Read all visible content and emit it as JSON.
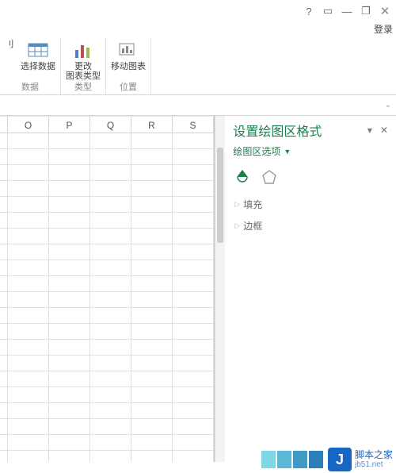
{
  "titlebar": {
    "help": "?",
    "ribbon_toggle": "▭",
    "minimize": "—",
    "restore": "❐",
    "close": "✕"
  },
  "login_label": "登录",
  "ribbon": {
    "group_data": {
      "btn1_frag": "刂",
      "btn2": "选择数据",
      "name": "数据"
    },
    "group_type": {
      "btn": "更改\n图表类型",
      "name": "类型"
    },
    "group_pos": {
      "btn": "移动图表",
      "name": "位置"
    }
  },
  "columns": [
    "O",
    "P",
    "Q",
    "R",
    "S"
  ],
  "pane": {
    "title": "设置绘图区格式",
    "dropdown": "绘图区选项",
    "section_fill": "填充",
    "section_border": "边框"
  },
  "watermark": {
    "text": "脚本之家",
    "url": "jb51.net"
  }
}
